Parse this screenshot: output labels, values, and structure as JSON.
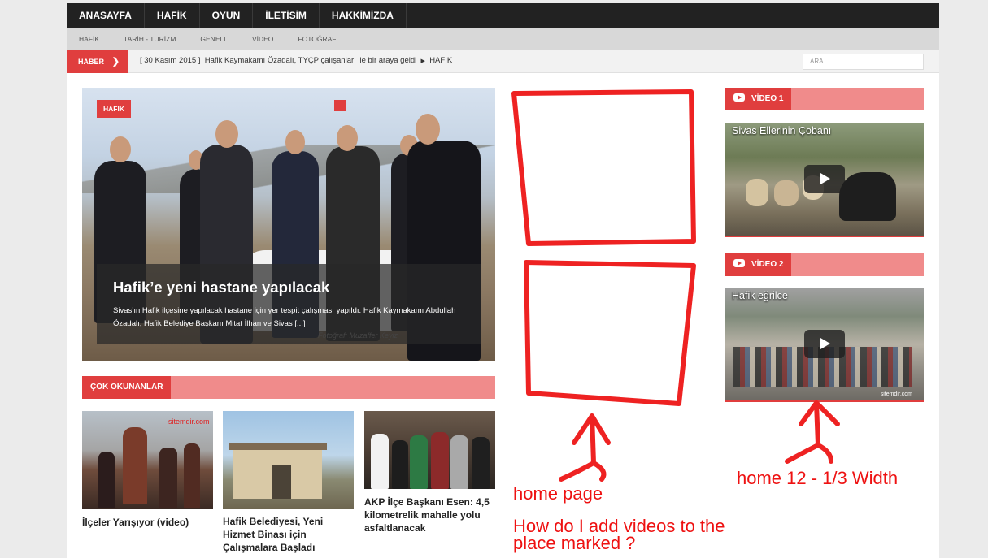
{
  "nav_main": [
    "ANASAYFA",
    "HAFİK",
    "OYUN",
    "İLETİSİM",
    "HAKKİMİZDA"
  ],
  "nav_sub": [
    "HAFİK",
    "TARİH - TURİZM",
    "GENELL",
    "VİDEO",
    "FOTOĞRAF"
  ],
  "ticker": {
    "badge": "HABER",
    "date": "[ 30 Kasım 2015 ]",
    "headline": "Hafik Kaymakamı Özadalı, TYÇP çalışanları ile bir araya geldi",
    "category": "HAFİK",
    "search_placeholder": "ARA ..."
  },
  "hero": {
    "tag": "HAFİK",
    "title": "Hafik’e yeni hastane yapılacak",
    "excerpt": "Sivas’ın Hafik ilçesine yapılacak hastane için yer tespit çalışması yapıldı. Hafik Kaymakamı Abdullah Özadalı, Hafik Belediye Başkanı Mitat İlhan ve Sivas [...]",
    "credit": "Fotoğraf: Muzaffer Keyiz"
  },
  "popular": {
    "heading": "ÇOK OKUNANLAR",
    "items": [
      {
        "title": "İlçeler Yarışıyor (video)",
        "watermark": "sitemdir.com"
      },
      {
        "title": "Hafik Belediyesi, Yeni Hizmet Binası için Çalışmalara Başladı",
        "watermark": ""
      },
      {
        "title": "AKP İlçe Başkanı Esen: 4,5 kilometrelik mahalle yolu asfaltlanacak",
        "watermark": ""
      }
    ]
  },
  "videos": [
    {
      "heading": "VİDEO 1",
      "title": "Sivas Ellerinin Çobanı",
      "watermark": ""
    },
    {
      "heading": "VİDEO 2",
      "title": "Hafik eğrilce",
      "watermark": "sitemdir.com"
    }
  ],
  "annotations": {
    "home_page": "home page",
    "width_note": "home 12 - 1/3 Width",
    "question_line1": "How do I add videos to the",
    "question_line2": "place marked ?"
  },
  "colors": {
    "accent": "#e03e3e",
    "accent_light": "#f08b8b",
    "nav_dark": "#222222",
    "annotation": "#ee1111"
  }
}
